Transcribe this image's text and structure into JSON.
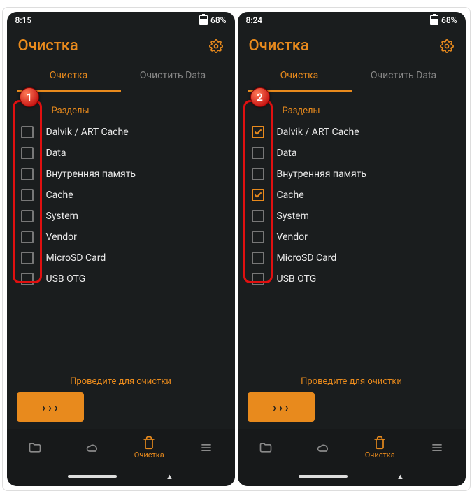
{
  "screens": [
    {
      "step": "1",
      "status": {
        "time": "8:15",
        "battery": "68%"
      },
      "header": {
        "title": "Очистка"
      },
      "tabs": [
        {
          "label": "Очистка",
          "active": true
        },
        {
          "label": "Очистить Data",
          "active": false
        }
      ],
      "section_label": "Разделы",
      "items": [
        {
          "label": "Dalvik / ART Cache",
          "checked": false
        },
        {
          "label": "Data",
          "checked": false
        },
        {
          "label": "Внутренняя память",
          "checked": false
        },
        {
          "label": "Cache",
          "checked": false
        },
        {
          "label": "System",
          "checked": false
        },
        {
          "label": "Vendor",
          "checked": false
        },
        {
          "label": "MicroSD Card",
          "checked": false
        },
        {
          "label": "USB OTG",
          "checked": false
        }
      ],
      "swipe_text": "Проведите для очистки",
      "nav_active_label": "Очистка"
    },
    {
      "step": "2",
      "status": {
        "time": "8:24",
        "battery": "68%"
      },
      "header": {
        "title": "Очистка"
      },
      "tabs": [
        {
          "label": "Очистка",
          "active": true
        },
        {
          "label": "Очистить Data",
          "active": false
        }
      ],
      "section_label": "Разделы",
      "items": [
        {
          "label": "Dalvik / ART Cache",
          "checked": true
        },
        {
          "label": "Data",
          "checked": false
        },
        {
          "label": "Внутренняя память",
          "checked": false
        },
        {
          "label": "Cache",
          "checked": true
        },
        {
          "label": "System",
          "checked": false
        },
        {
          "label": "Vendor",
          "checked": false
        },
        {
          "label": "MicroSD Card",
          "checked": false
        },
        {
          "label": "USB OTG",
          "checked": false
        }
      ],
      "swipe_text": "Проведите для очистки",
      "nav_active_label": "Очистка"
    }
  ]
}
